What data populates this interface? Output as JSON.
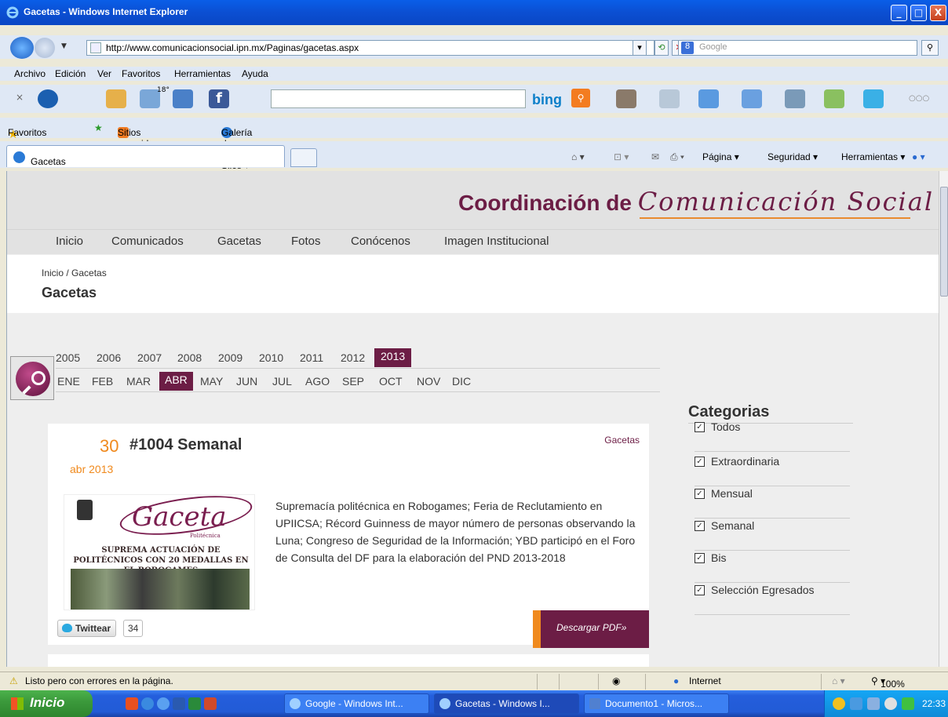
{
  "window": {
    "title": "Gacetas - Windows Internet Explorer",
    "min": "_",
    "max": "□",
    "close": "X"
  },
  "address": {
    "url": "http://www.comunicacionsocial.ipn.mx/Paginas/gacetas.aspx",
    "search_placeholder": "Google"
  },
  "menu": [
    "Archivo",
    "Edición",
    "Ver",
    "Favoritos",
    "Herramientas",
    "Ayuda"
  ],
  "toolbar": {
    "weather": "18°",
    "bing": "bing",
    "more": "○○○"
  },
  "favorites": {
    "favoritos": "Favoritos",
    "sitios": "Sitios sugeridos ▾",
    "galeria": "Galería de Web Slice ▾"
  },
  "tabs": {
    "active": "Gacetas"
  },
  "commandbar": {
    "pagina": "Página ▾",
    "seguridad": "Seguridad ▾",
    "herramientas": "Herramientas ▾"
  },
  "site": {
    "brand_bold": "Coordinación de ",
    "brand_script": "Comunicación Social",
    "nav": [
      "Inicio",
      "Comunicados",
      "Gacetas",
      "Fotos",
      "Conócenos",
      "Imagen Institucional"
    ],
    "breadcrumb": "Inicio / Gacetas",
    "page_title": "Gacetas",
    "years": [
      "2005",
      "2006",
      "2007",
      "2008",
      "2009",
      "2010",
      "2011",
      "2012",
      "2013"
    ],
    "selected_year": "2013",
    "months": [
      "ENE",
      "FEB",
      "MAR",
      "ABR",
      "MAY",
      "JUN",
      "JUL",
      "AGO",
      "SEP",
      "OCT",
      "NOV",
      "DIC"
    ],
    "selected_month": "ABR"
  },
  "article": {
    "day": "30",
    "title": "#1004 Semanal",
    "date": "abr 2013",
    "category": "Gacetas",
    "thumb_title": "Gaceta",
    "thumb_sub": "Politécnica",
    "thumb_headline": "SUPREMA ACTUACIÓN DE POLITÉCNICOS CON 20 MEDALLAS EN EL ROBOGAMES",
    "summary": "Supremacía politécnica en Robogames; Feria de Reclutamiento en UPIICSA; Récord Guinness de mayor número de personas observando la Luna; Congreso de Seguridad de la Información; YBD participó en el Foro de Consulta del DF para la elaboración del PND 2013-2018",
    "pdf": "Descargar PDF»",
    "tweet": "Twittear",
    "tweet_count": "34"
  },
  "categories": {
    "heading": "Categorias",
    "items": [
      "Todos",
      "Extraordinaria",
      "Mensual",
      "Semanal",
      "Bis",
      "Selección Egresados"
    ]
  },
  "status": {
    "message": "Listo pero con errores en la página.",
    "zone": "Internet",
    "zoom": "100%"
  },
  "taskbar": {
    "start": "Inicio",
    "tasks": [
      "Google - Windows Int...",
      "Gacetas - Windows I...",
      "Documento1 - Micros..."
    ],
    "clock": "22:33"
  },
  "colors": {
    "brand": "#6c1d45",
    "accent": "#f08a1e"
  }
}
